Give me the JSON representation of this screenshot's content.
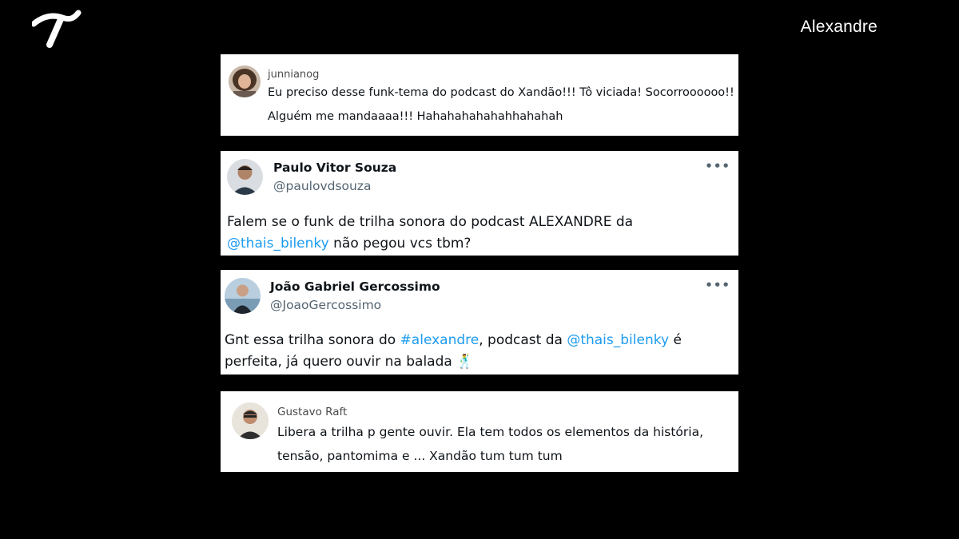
{
  "header": {
    "logo_icon": "brand-logo-icon",
    "title": "Alexandre"
  },
  "tweets": [
    {
      "handle": "junnianog",
      "lines": [
        "Eu preciso desse funk-tema do podcast do Xandão!!! Tô viciada! Socorroooooo!!",
        "Alguém me mandaaaa!!! Hahahahahahahhahahah"
      ]
    },
    {
      "name": "Paulo Vitor Souza",
      "handle": "@paulovdsouza",
      "more": "•••",
      "text_pre": "Falem se o funk de trilha sonora do podcast ALEXANDRE da ",
      "mention": "@thais_bilenky",
      "text_post": " não pegou vcs tbm?"
    },
    {
      "name": "João Gabriel Gercossimo",
      "handle": "@JoaoGercossimo",
      "more": "•••",
      "text_pre": "Gnt essa trilha sonora do ",
      "hashtag": "#alexandre",
      "text_mid": ", podcast da ",
      "mention": "@thais_bilenky",
      "text_post": " é perfeita, já quero ouvir na balada ",
      "emoji": "🕺"
    },
    {
      "handle": "Gustavo Raft",
      "lines": [
        "Libera a trilha p gente ouvir. Ela tem todos os elementos da história,",
        "tensão, pantomima e ... Xandão tum tum tum"
      ]
    }
  ],
  "colors": {
    "background": "#000000",
    "card": "#ffffff",
    "link": "#1d9bf0",
    "muted": "#536471",
    "text": "#0f1419"
  }
}
